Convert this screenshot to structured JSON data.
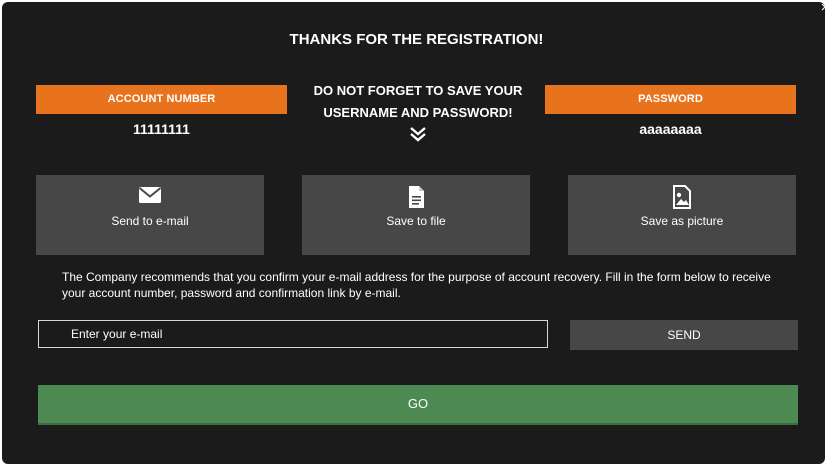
{
  "close": {
    "icon": "close-icon",
    "glyph": "×"
  },
  "title": "THANKS FOR THE REGISTRATION!",
  "account": {
    "label": "ACCOUNT NUMBER",
    "value": "11111111"
  },
  "reminder": {
    "line1": "DO NOT FORGET TO SAVE YOUR",
    "line2": "USERNAME AND PASSWORD!",
    "icon": "double-chevron-down-icon"
  },
  "password": {
    "label": "PASSWORD",
    "value": "aaaaaaaa"
  },
  "actions": [
    {
      "label": "Send to e-mail",
      "icon": "envelope-icon"
    },
    {
      "label": "Save to file",
      "icon": "document-icon"
    },
    {
      "label": "Save as picture",
      "icon": "image-icon"
    }
  ],
  "note": "The Company recommends that you confirm your e-mail address for the purpose of account recovery. Fill in the form below to receive your account number, password and confirmation link by e-mail.",
  "email_form": {
    "placeholder": "Enter your e-mail",
    "value": "",
    "send_label": "SEND"
  },
  "go_label": "GO",
  "colors": {
    "background": "#1b1b1b",
    "accent_orange": "#e8731c",
    "tile_gray": "#474747",
    "go_green": "#4d8a52"
  }
}
